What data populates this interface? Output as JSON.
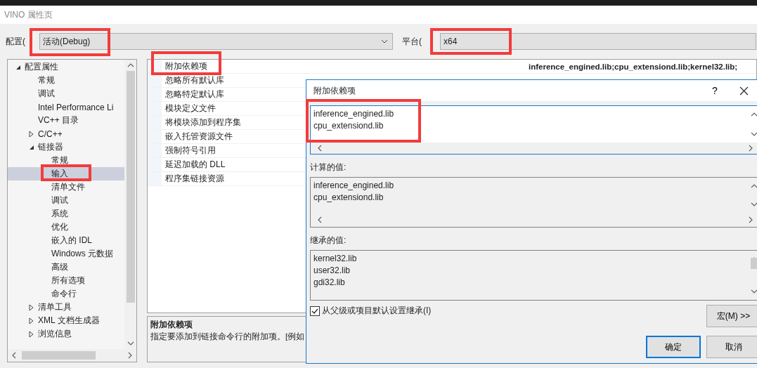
{
  "window": {
    "title": "VINO 属性页"
  },
  "toolbar": {
    "config_label": "配置(",
    "config_value": "活动(Debug)",
    "config_annotated": true,
    "platform_label": "平台(",
    "platform_value": "x64",
    "platform_annotated": true
  },
  "tree": {
    "items": [
      {
        "label": "配置属性",
        "expanded": true,
        "selected": false,
        "children": [
          {
            "label": "常规",
            "selected": false
          },
          {
            "label": "调试",
            "selected": false
          },
          {
            "label": "Intel Performance Li",
            "selected": false
          },
          {
            "label": "VC++ 目录",
            "selected": false
          },
          {
            "label": "C/C++",
            "expanded": false,
            "selected": false
          },
          {
            "label": "链接器",
            "expanded": true,
            "selected": false,
            "children": [
              {
                "label": "常规",
                "selected": false
              },
              {
                "label": "输入",
                "selected": true,
                "annotated": true
              },
              {
                "label": "清单文件",
                "selected": false
              },
              {
                "label": "调试",
                "selected": false
              },
              {
                "label": "系统",
                "selected": false
              },
              {
                "label": "优化",
                "selected": false
              },
              {
                "label": "嵌入的 IDL",
                "selected": false
              },
              {
                "label": "Windows 元数据",
                "selected": false
              },
              {
                "label": "高级",
                "selected": false
              },
              {
                "label": "所有选项",
                "selected": false
              },
              {
                "label": "命令行",
                "selected": false
              }
            ]
          },
          {
            "label": "清单工具",
            "expanded": false,
            "selected": false
          },
          {
            "label": "XML 文档生成器",
            "expanded": false,
            "selected": false
          },
          {
            "label": "浏览信息",
            "expanded": false,
            "selected": false
          }
        ]
      }
    ]
  },
  "properties": {
    "rows": [
      {
        "name": "附加依赖项",
        "value": "inference_engined.lib;cpu_extensiond.lib;kernel32.lib;",
        "annotated": true
      },
      {
        "name": "忽略所有默认库"
      },
      {
        "name": "忽略特定默认库"
      },
      {
        "name": "模块定义文件"
      },
      {
        "name": "将模块添加到程序集"
      },
      {
        "name": "嵌入托管资源文件"
      },
      {
        "name": "强制符号引用"
      },
      {
        "name": "延迟加载的 DLL"
      },
      {
        "name": "程序集链接资源"
      }
    ],
    "description": {
      "title": "附加依赖项",
      "text": "指定要添加到链接命令行的附加项。[例如"
    }
  },
  "dialog": {
    "title": "附加依赖项",
    "help": "?",
    "edit_lines": [
      "inference_engined.lib",
      "cpu_extensiond.lib"
    ],
    "edit_annotated": true,
    "computed_label": "计算的值:",
    "computed_lines": [
      "inference_engined.lib",
      "cpu_extensiond.lib"
    ],
    "inherited_label": "继承的值:",
    "inherited_lines": [
      "kernel32.lib",
      "user32.lib",
      "gdi32.lib"
    ],
    "inherit_checkbox": {
      "label": "从父级或项目默认设置继承(I)",
      "checked": true
    },
    "macro_button": "宏(M) >>",
    "ok_button": "确定",
    "cancel_button": "取消"
  }
}
